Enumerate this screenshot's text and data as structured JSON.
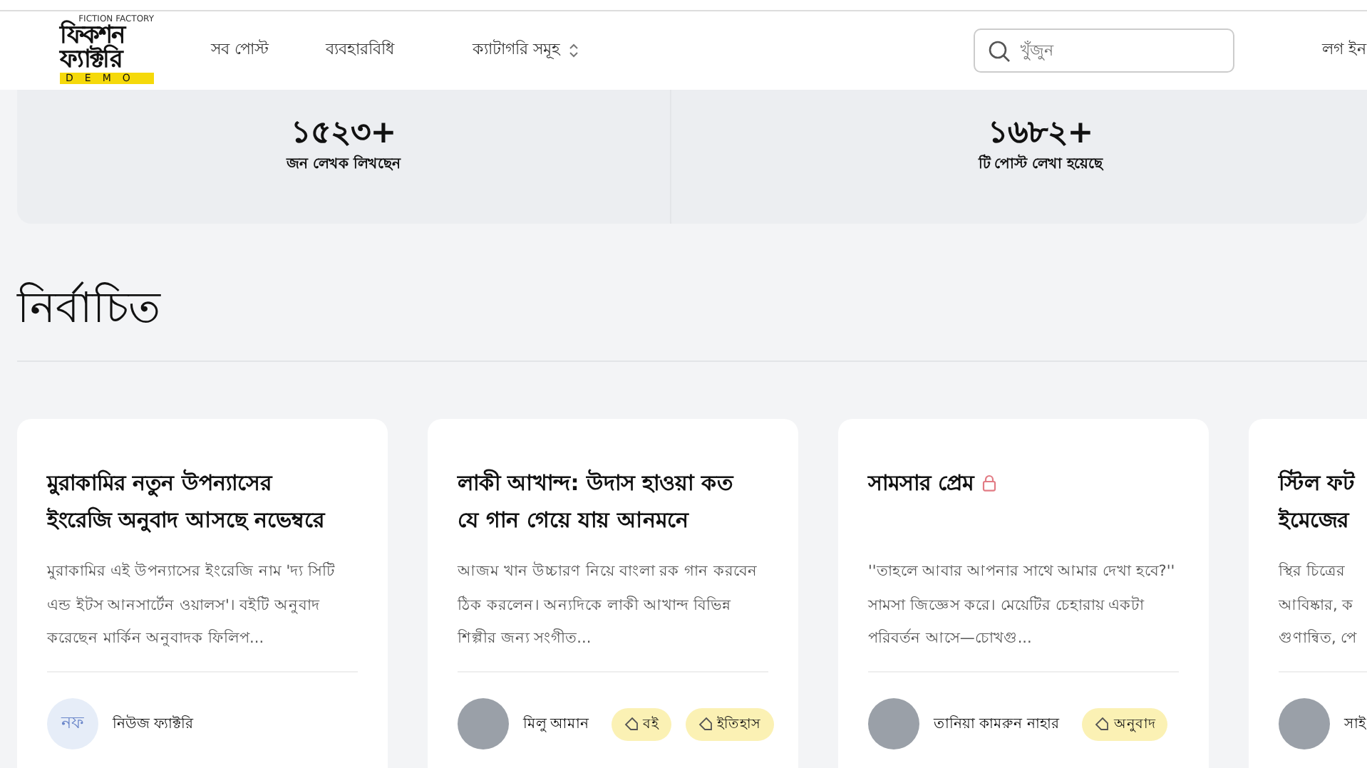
{
  "header": {
    "logo": {
      "tagline": "FICTION FACTORY",
      "line1": "ফিকশন",
      "line2": "ফ্যাক্টরি",
      "badge": "DEMO"
    },
    "nav": [
      {
        "label": "সব পোস্ট",
        "kind": "link"
      },
      {
        "label": "ব্যবহারবিধি",
        "kind": "link"
      },
      {
        "label": "ক্যাটাগরি সমূহ",
        "kind": "dropdown"
      }
    ],
    "search": {
      "placeholder": "খুঁজুন"
    },
    "login": "লগ ইন"
  },
  "stats": [
    {
      "value": "১৫২৩+",
      "label": "জন লেখক লিখছেন"
    },
    {
      "value": "১৬৮২+",
      "label": "টি পোস্ট লেখা হয়েছে"
    }
  ],
  "section_title": "নির্বাচিত",
  "posts": [
    {
      "title": "মুরাকামির নতুন উপন্যাসের ইংরেজি অনুবাদ আসছে নভেম্বরে",
      "locked": false,
      "excerpt": "মুরাকামির এই উপন্যাসের ইংরেজি নাম 'দ্য সিটি এন্ড ইটস আনসার্টেন ওয়ালস'। বইটি অনুবাদ করেছেন মার্কিন অনুবাদক ফিলিপ...",
      "author": {
        "kind": "initials",
        "initials": "নফ",
        "name": "নিউজ ফ্যাক্টরি"
      }
    },
    {
      "title": "লাকী আখান্দ: উদাস হাওয়া কত যে গান গেয়ে যায় আনমনে",
      "locked": false,
      "excerpt": "আজম খান উচ্চারণ নিয়ে বাংলা রক গান করবেন ঠিক করলেন। অন্যদিকে লাকী আখান্দ বিভিন্ন শিল্পীর জন্য সংগীত...",
      "author": {
        "kind": "photo",
        "name": "মিলু আমান"
      },
      "tags": [
        "বই",
        "ইতিহাস"
      ]
    },
    {
      "title": "সামসার প্রেম",
      "locked": true,
      "excerpt": "''তাহলে আবার আপনার সাথে আমার দেখা হবে?'' সামসা জিজ্ঞেস করে। মেয়েটির চেহারায় একটা পরিবর্তন আসে—চোখগু...",
      "author": {
        "kind": "photo",
        "name": "তানিয়া কামরুন নাহার"
      },
      "tags": [
        "অনুবাদ"
      ]
    },
    {
      "title": "স্টিল ফট\nইমেজের",
      "locked": false,
      "excerpt": "স্থির চিত্রের\nআবিষ্কার, ক\nগুণান্বিত, পে",
      "author": {
        "kind": "photo",
        "name": "সাই"
      }
    }
  ]
}
